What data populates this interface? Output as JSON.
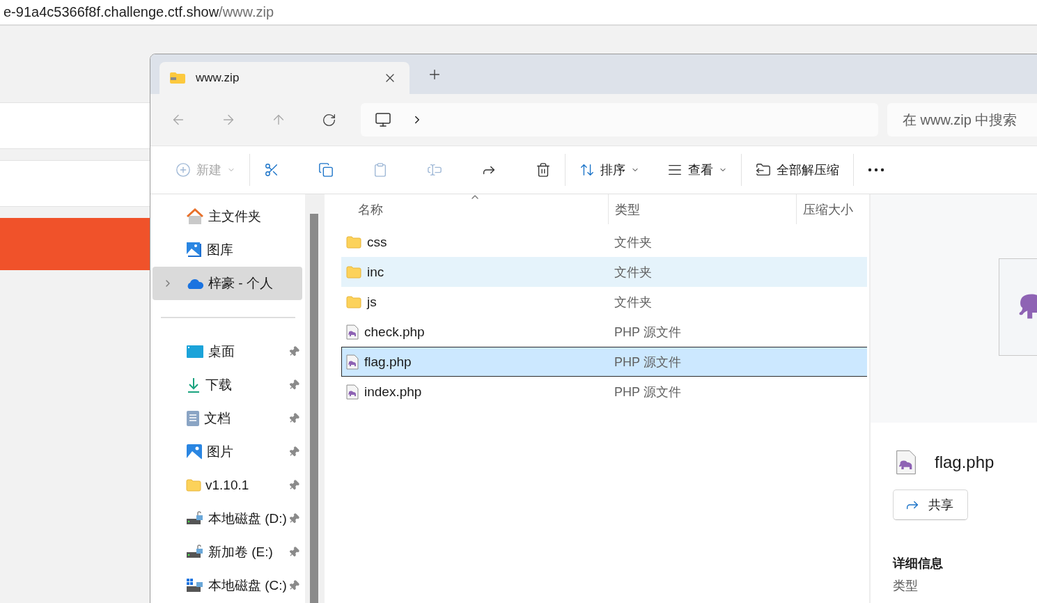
{
  "browser": {
    "url_host": "e-91a4c5366f8f.challenge.ctf.show",
    "url_path": "/www.zip"
  },
  "explorer": {
    "tabs": [
      {
        "title": "www.zip",
        "selected": true
      }
    ],
    "search": {
      "placeholder": "在 www.zip 中搜索"
    },
    "toolbar": {
      "groups": [
        [
          {
            "kind": "new",
            "label": "新建",
            "disabled": true
          }
        ],
        [
          {
            "kind": "cut",
            "disabled": false
          },
          {
            "kind": "copy",
            "disabled": false
          },
          {
            "kind": "paste",
            "disabled": true
          },
          {
            "kind": "rename",
            "disabled": true
          },
          {
            "kind": "share",
            "disabled": false
          },
          {
            "kind": "delete",
            "disabled": false
          }
        ],
        [
          {
            "kind": "sort",
            "label": "排序",
            "disabled": false
          },
          {
            "kind": "view",
            "label": "查看",
            "disabled": false
          }
        ],
        [
          {
            "kind": "extract",
            "label": "全部解压缩",
            "disabled": false
          }
        ],
        [
          {
            "kind": "more",
            "disabled": false
          }
        ]
      ]
    },
    "sidebar": {
      "groups": [
        [
          {
            "kind": "home",
            "label": "主文件夹",
            "selected": false,
            "expandable": false,
            "pinned": false
          },
          {
            "kind": "gallery",
            "label": "图库",
            "selected": false,
            "expandable": false,
            "pinned": false
          },
          {
            "kind": "cloud",
            "label": "梓豪 - 个人",
            "selected": true,
            "expandable": true,
            "pinned": false
          }
        ],
        [
          {
            "kind": "desktop",
            "label": "桌面",
            "selected": false,
            "expandable": false,
            "pinned": true
          },
          {
            "kind": "download",
            "label": "下载",
            "selected": false,
            "expandable": false,
            "pinned": true
          },
          {
            "kind": "document",
            "label": "文档",
            "selected": false,
            "expandable": false,
            "pinned": true
          },
          {
            "kind": "pictures",
            "label": "图片",
            "selected": false,
            "expandable": false,
            "pinned": true
          },
          {
            "kind": "folder",
            "label": "v1.10.1",
            "selected": false,
            "expandable": false,
            "pinned": true
          },
          {
            "kind": "drive",
            "label": "本地磁盘 (D:)",
            "selected": false,
            "expandable": false,
            "pinned": true
          },
          {
            "kind": "drive",
            "label": "新加卷 (E:)",
            "selected": false,
            "expandable": false,
            "pinned": true
          },
          {
            "kind": "system-drive",
            "label": "本地磁盘 (C:)",
            "selected": false,
            "expandable": false,
            "pinned": true
          }
        ]
      ]
    },
    "columns": [
      {
        "label": "名称",
        "sorted": true
      },
      {
        "label": "类型",
        "sorted": false
      },
      {
        "label": "压缩大小",
        "sorted": false
      }
    ],
    "files": [
      {
        "name": "css",
        "type": "文件夹",
        "kind": "folder",
        "selected": false,
        "hovered": false
      },
      {
        "name": "inc",
        "type": "文件夹",
        "kind": "folder",
        "selected": false,
        "hovered": true
      },
      {
        "name": "js",
        "type": "文件夹",
        "kind": "folder",
        "selected": false,
        "hovered": false
      },
      {
        "name": "check.php",
        "type": "PHP 源文件",
        "kind": "php",
        "selected": false,
        "hovered": false
      },
      {
        "name": "flag.php",
        "type": "PHP 源文件",
        "kind": "php",
        "selected": true,
        "hovered": false
      },
      {
        "name": "index.php",
        "type": "PHP 源文件",
        "kind": "php",
        "selected": false,
        "hovered": false
      }
    ],
    "details": {
      "name": "flag.php",
      "share_label": "共享",
      "section_title": "详细信息",
      "fields": [
        "类型"
      ]
    }
  }
}
